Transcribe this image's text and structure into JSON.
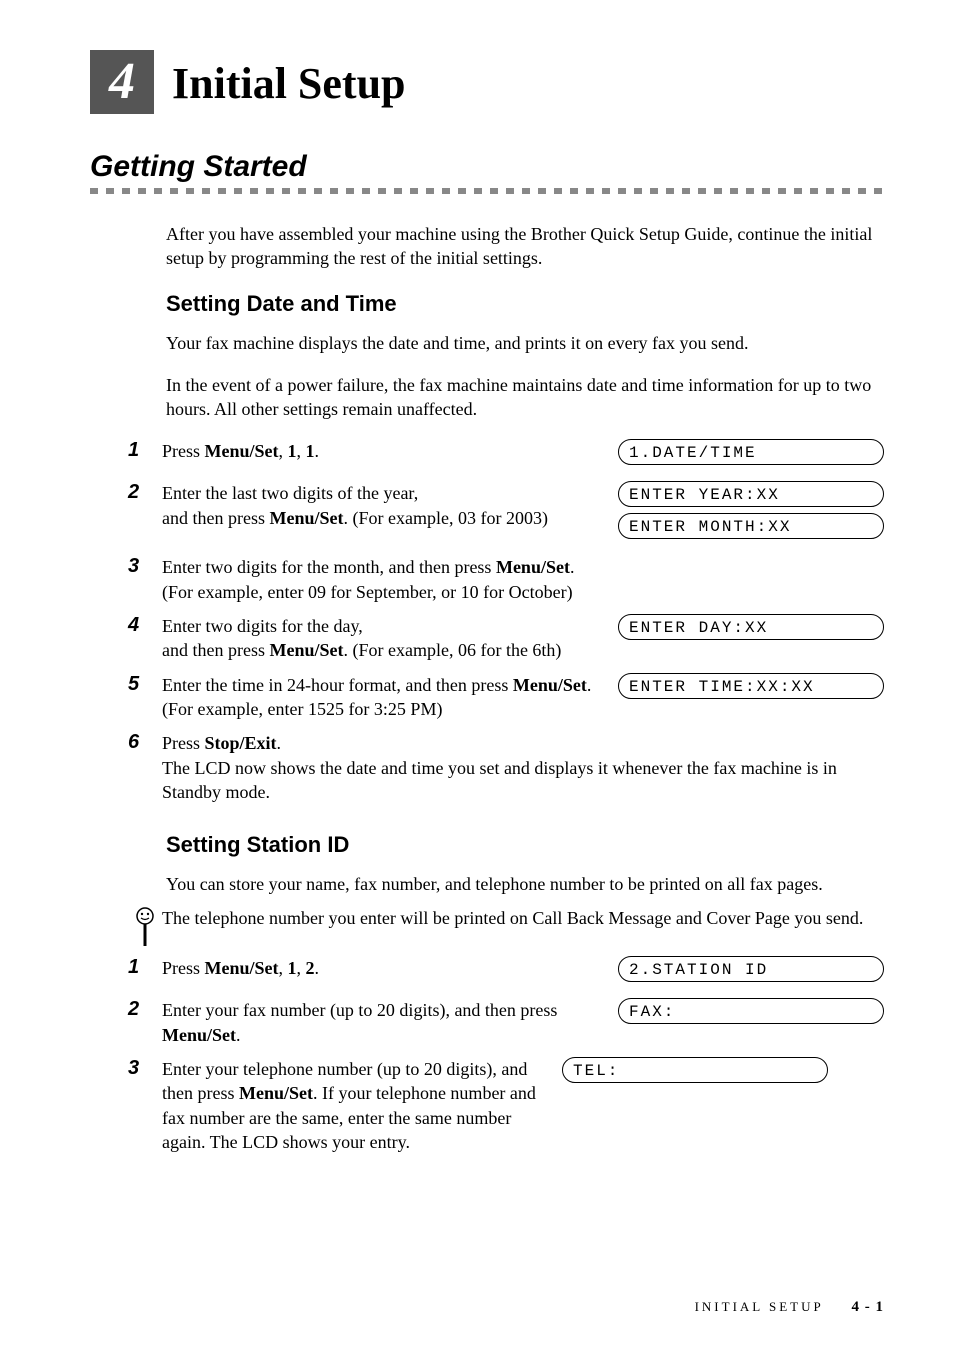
{
  "chapter": {
    "number": "4",
    "title": "Initial Setup"
  },
  "section1": {
    "title": "Getting Started"
  },
  "intro": "After you have assembled your machine using the Brother Quick Setup Guide, continue the initial setup by programming the rest of the initial settings.",
  "sub1": {
    "title": "Setting Date and Time",
    "p1": "Your fax machine displays the date and time, and prints it on every fax you send.",
    "p2": "In the event of a power failure, the fax machine maintains date and time information for up to two hours. All other settings remain unaffected.",
    "steps": {
      "s1": {
        "num": "1",
        "pre": "Press ",
        "b1": "Menu/Set",
        "mid1": ", ",
        "b2": "1",
        "mid2": ", ",
        "b3": "1",
        "post": "."
      },
      "s2": {
        "num": "2",
        "line1a": "Enter the last two digits of the year,",
        "line2a": "and then press ",
        "b1": "Menu/Set",
        "line2b": ". (For example, 03 for 2003)"
      },
      "s3": {
        "num": "3",
        "line1a": "Enter two digits for the month, and then press ",
        "b1": "Menu/Set",
        "line1b": ". (For example, enter 09 for September, or 10 for October)"
      },
      "s4": {
        "num": "4",
        "line1a": "Enter two digits for the day,",
        "line2a": "and then press ",
        "b1": "Menu/Set",
        "line2b": ". (For example, 06 for the 6th)"
      },
      "s5": {
        "num": "5",
        "line1a": "Enter the time in 24-hour format, and then press ",
        "b1": "Menu/Set",
        "line1b": ". (For example, enter 1525 for 3:25 PM)"
      },
      "s6": {
        "num": "6",
        "pre": "Press ",
        "b1": "Stop/Exit",
        "post": ".",
        "line2": "The LCD now shows the date and time you set and displays it whenever the fax machine is in Standby mode."
      }
    },
    "lcd": {
      "l1": "1.DATE/TIME",
      "l2": "ENTER YEAR:XX",
      "l3": "ENTER MONTH:XX",
      "l4": "ENTER DAY:XX",
      "l5": "ENTER TIME:XX:XX"
    }
  },
  "sub2": {
    "title": "Setting Station ID",
    "p1": "You can store your name, fax number, and telephone number to be printed on all fax pages.",
    "note": "The telephone number you enter will be printed on Call Back Message and Cover Page you send.",
    "steps": {
      "s1": {
        "num": "1",
        "pre": "Press ",
        "b1": "Menu/Set",
        "mid1": ", ",
        "b2": "1",
        "mid2": ", ",
        "b3": "2",
        "post": "."
      },
      "s2": {
        "num": "2",
        "line1a": "Enter your fax number (up to 20 digits), and then press ",
        "b1": "Menu/Set",
        "post": "."
      },
      "s3": {
        "num": "3",
        "line1a": "Enter your telephone number (up to 20 digits), and then press ",
        "b1": "Menu/Set",
        "line1b": ". If your telephone number and fax number are the same, enter the same number again. The LCD shows your entry."
      }
    },
    "lcd": {
      "l1": "2.STATION ID",
      "l2": "FAX:",
      "l3": "TEL:"
    }
  },
  "footer": {
    "section": "INITIAL SETUP",
    "page": "4 - 1"
  }
}
